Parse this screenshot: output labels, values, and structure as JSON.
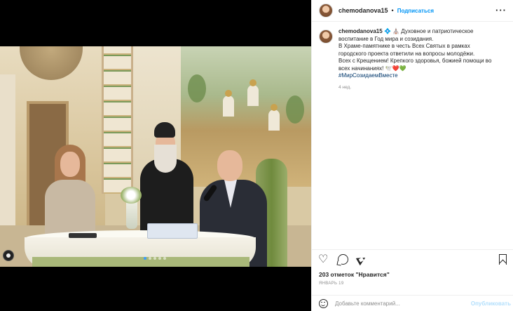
{
  "header": {
    "username": "chemodanova15",
    "separator": "•",
    "follow_label": "Подписаться",
    "more_label": "···"
  },
  "caption": {
    "username": "chemodanova15",
    "line1": "💠 ⛪ Духовное и патриотическое",
    "line2": "воспитание в Год мира и созидания.",
    "line3": "В Храме-памятнике в честь Всех Святых в рамках",
    "line4": "городского проекта ответили на вопросы молодёжи.",
    "line5": "Всех с Крещением! Крепкого здоровья, божией помощи во",
    "line6": "всех начинаниях! 🕊️❤️💚",
    "hashtag": "#МирСозидаемВместе",
    "time": "4 нед."
  },
  "post": {
    "likes": "203 отметок \"Нравится\"",
    "date": "ЯНВАРЬ 19",
    "carousel_count": 5,
    "carousel_active": 0
  },
  "comment": {
    "placeholder": "Добавьте комментарий...",
    "publish_label": "Опубликовать"
  },
  "colors": {
    "accent": "#0095f6",
    "link": "#00376b",
    "muted": "#8e8e8e"
  },
  "icons": [
    "heart-icon",
    "comment-icon",
    "share-icon",
    "bookmark-icon",
    "emoji-icon",
    "reel-icon",
    "more-icon"
  ]
}
